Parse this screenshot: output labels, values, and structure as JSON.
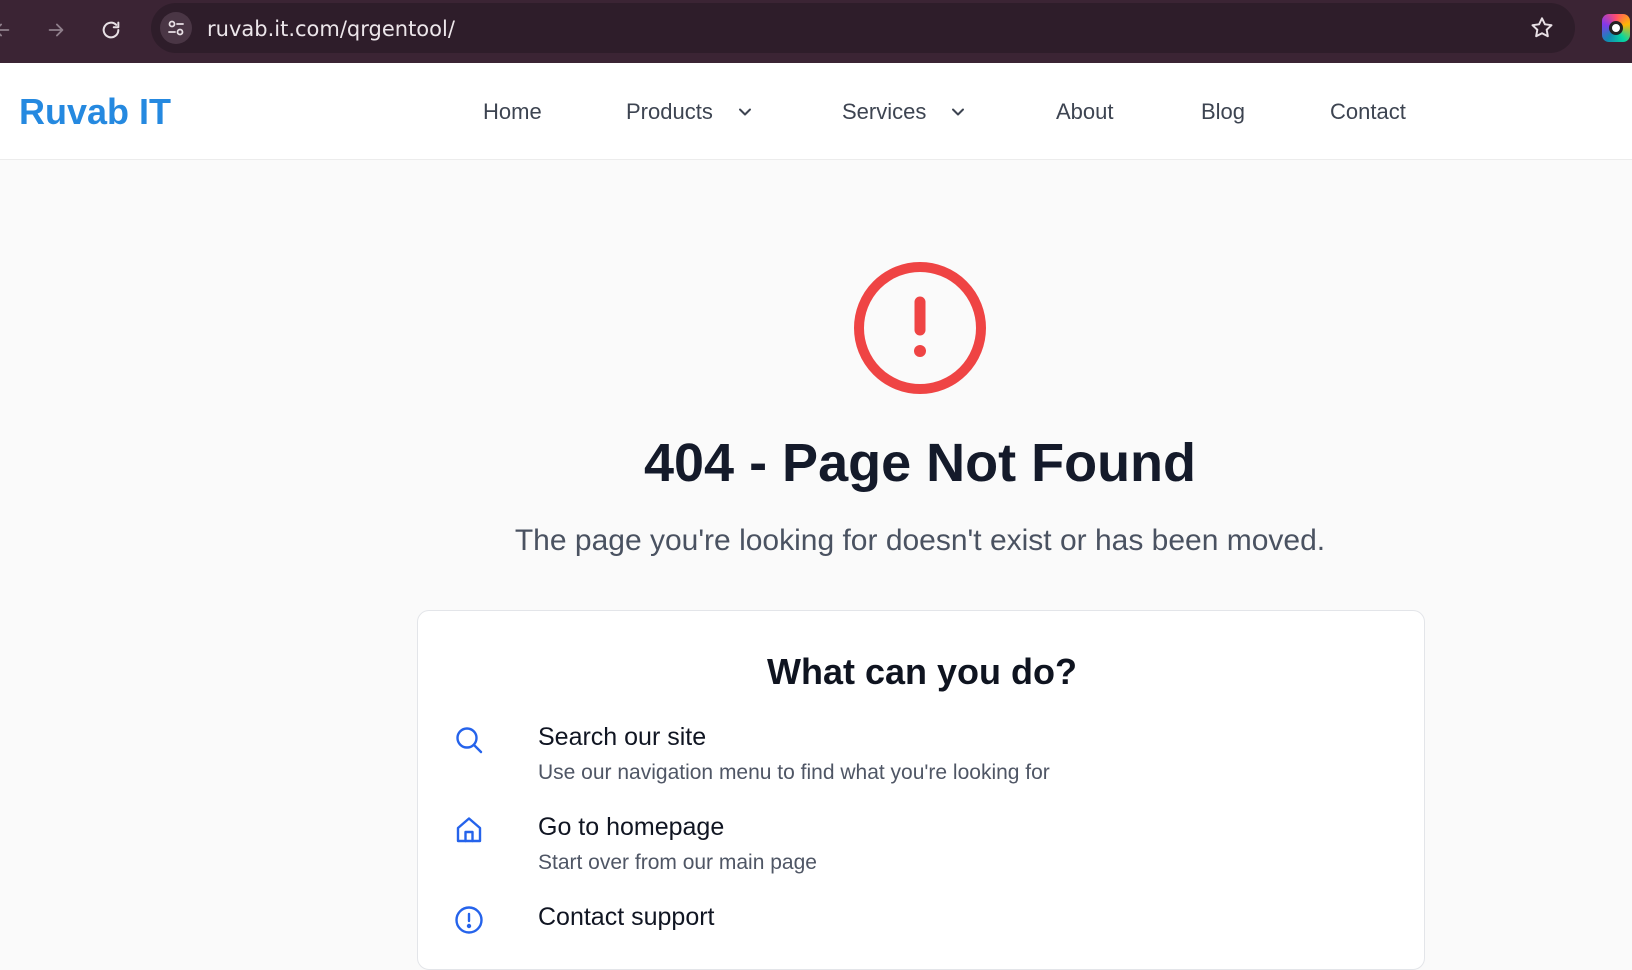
{
  "browser": {
    "url": "ruvab.it.com/qrgentool/",
    "icons": [
      "back-arrow-icon",
      "forward-arrow-icon",
      "reload-icon",
      "site-settings-icon",
      "bookmark-star-icon",
      "extension-icon"
    ]
  },
  "header": {
    "logo": "Ruvab IT",
    "nav": [
      {
        "label": "Home"
      },
      {
        "label": "Products",
        "dropdown": true
      },
      {
        "label": "Services",
        "dropdown": true
      },
      {
        "label": "About"
      },
      {
        "label": "Blog"
      },
      {
        "label": "Contact"
      }
    ]
  },
  "error": {
    "icon": "exclamation-circle-icon",
    "title": "404 - Page Not Found",
    "message": "The page you're looking for doesn't exist or has been moved."
  },
  "help_card": {
    "title": "What can you do?",
    "options": [
      {
        "icon": "search-icon",
        "title": "Search our site",
        "description": "Use our navigation menu to find what you're looking for"
      },
      {
        "icon": "home-icon",
        "title": "Go to homepage",
        "description": "Start over from our main page"
      },
      {
        "icon": "info-circle-icon",
        "title": "Contact support",
        "description": ""
      }
    ]
  },
  "colors": {
    "brand_blue": "#2589e0",
    "error_red": "#ef4444",
    "icon_blue": "#2563eb",
    "browser_chrome": "#3b2434"
  }
}
